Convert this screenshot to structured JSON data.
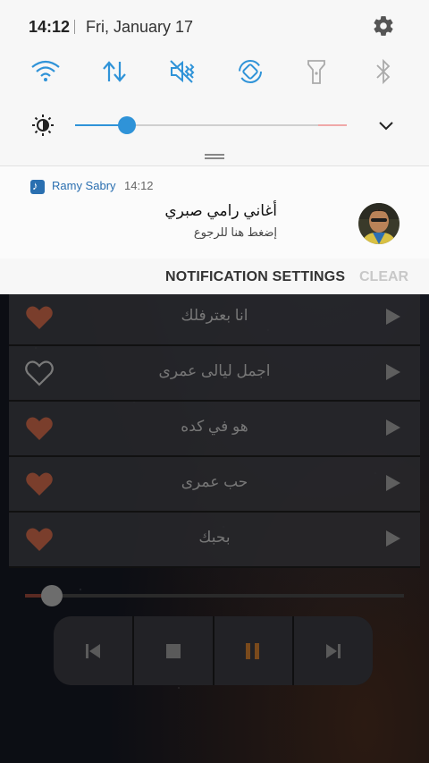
{
  "status": {
    "time": "14:12",
    "date": "Fri, January 17"
  },
  "quick_settings": [
    {
      "icon": "wifi-icon",
      "active": true
    },
    {
      "icon": "mobile-data-icon",
      "active": true
    },
    {
      "icon": "mute-icon",
      "active": true
    },
    {
      "icon": "auto-rotate-icon",
      "active": true
    },
    {
      "icon": "flashlight-icon",
      "active": false
    },
    {
      "icon": "bluetooth-icon",
      "active": false
    }
  ],
  "brightness": {
    "level": 0.19
  },
  "notification": {
    "app_name": "Ramy Sabry",
    "time": "14:12",
    "title": "أغاني رامي صبري",
    "text": "إضغط هنا للرجوع"
  },
  "actions": {
    "settings_label": "NOTIFICATION SETTINGS",
    "clear_label": "CLEAR"
  },
  "songs": [
    {
      "title": "انا بعترفلك",
      "favorite": true
    },
    {
      "title": "اجمل ليالى عمرى",
      "favorite": false
    },
    {
      "title": "هو في كده",
      "favorite": true
    },
    {
      "title": "حب عمرى",
      "favorite": true
    },
    {
      "title": "بحبك",
      "favorite": true
    }
  ],
  "player": {
    "progress": 0.07,
    "state": "paused"
  },
  "colors": {
    "accent": "#2f93d8",
    "heart": "#7a3e2c",
    "pause": "#7a4a1c"
  }
}
